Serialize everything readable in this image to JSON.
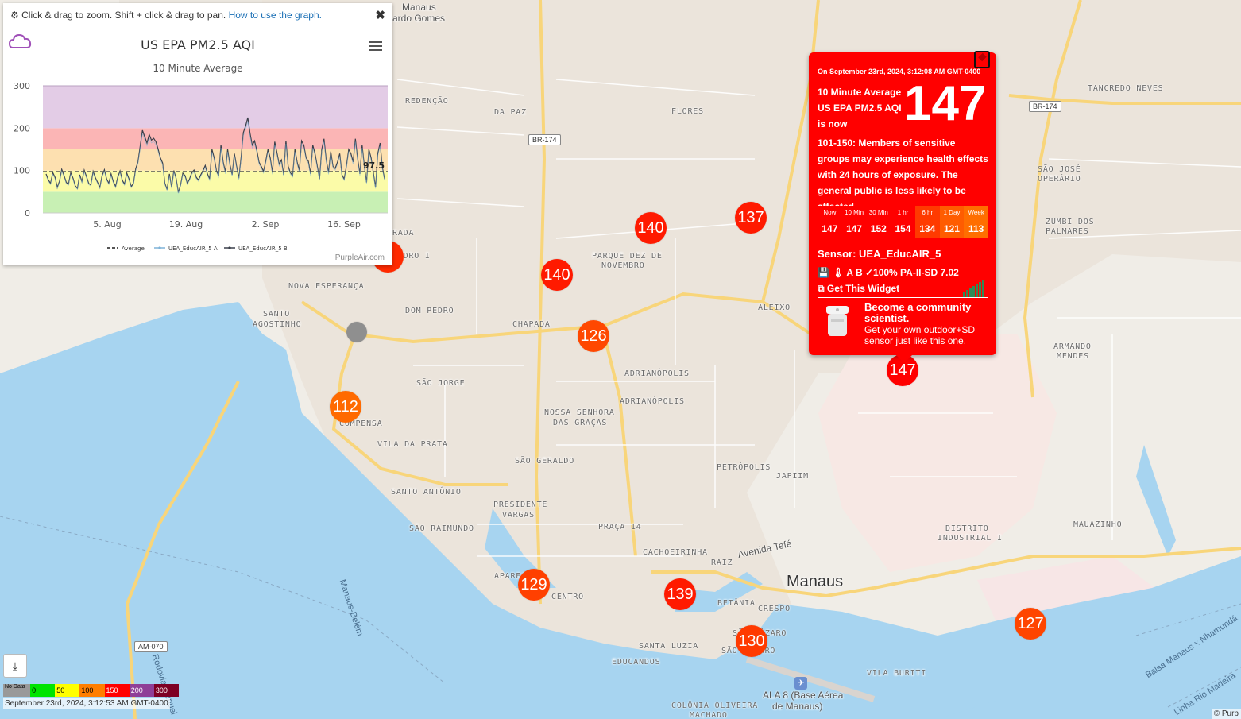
{
  "graph_panel": {
    "hint_text": "Click & drag to zoom. Shift + click & drag to pan.",
    "hint_link": "How to use the graph.",
    "close_icon": "close-icon",
    "credit": "PurpleAir.com",
    "chart_data": {
      "type": "line",
      "title": "US EPA PM2.5 AQI",
      "subtitle": "10 Minute Average",
      "x_tick_labels": [
        "5. Aug",
        "19. Aug",
        "2. Sep",
        "16. Sep"
      ],
      "y_tick_labels": [
        "300",
        "200",
        "100",
        "0"
      ],
      "ylim": [
        0,
        300
      ],
      "average_value": 97.5,
      "average_label": "97.5",
      "aqi_bands": [
        {
          "from": 0,
          "to": 50,
          "color": "#c8f0b4"
        },
        {
          "from": 50,
          "to": 100,
          "color": "#fbfba8"
        },
        {
          "from": 100,
          "to": 150,
          "color": "#fde0b0"
        },
        {
          "from": 150,
          "to": 200,
          "color": "#fbb5b5"
        },
        {
          "from": 200,
          "to": 300,
          "color": "#e3cce6"
        }
      ],
      "series": [
        {
          "name": "Average",
          "style": "dashed",
          "color": "#555555"
        },
        {
          "name": "UEA_EducAIR_5 A",
          "color": "#7fb3d8"
        },
        {
          "name": "UEA_EducAIR_5 B",
          "color": "#3a3f4a",
          "values": [
            92,
            78,
            70,
            95,
            84,
            60,
            75,
            103,
            88,
            72,
            68,
            95,
            82,
            64,
            58,
            90,
            74,
            101,
            86,
            70,
            66,
            98,
            83,
            72,
            60,
            88,
            102,
            80,
            70,
            92,
            74,
            62,
            85,
            99,
            77,
            68,
            94,
            80,
            62,
            70,
            104,
            121,
            158,
            195,
            180,
            165,
            185,
            172,
            176,
            168,
            150,
            130,
            118,
            70,
            55,
            92,
            60,
            100,
            82,
            48,
            66,
            94,
            88,
            70,
            80,
            95,
            101,
            84,
            78,
            90,
            100,
            112,
            92,
            80,
            150,
            130,
            100,
            88,
            160,
            120,
            96,
            150,
            115,
            90,
            140,
            110,
            82,
            130,
            190,
            205,
            225,
            188,
            160,
            170,
            148,
            120,
            110,
            98,
            122,
            150,
            130,
            95,
            168,
            142,
            115,
            125,
            90,
            170,
            110,
            95,
            88,
            150,
            120,
            100,
            170,
            160,
            130,
            122,
            92,
            160,
            140,
            110,
            80,
            150,
            175,
            125,
            95,
            145,
            110,
            105,
            120,
            140,
            90,
            80,
            110,
            150,
            140,
            120,
            175,
            128,
            92,
            160,
            110,
            72,
            150,
            130,
            95,
            60,
            140,
            165,
            108,
            80
          ]
        }
      ]
    }
  },
  "sensor_popup": {
    "date": "On September 23rd, 2024, 3:12:08 AM GMT-0400",
    "avg_line1": "10 Minute Average",
    "avg_line2": "US EPA PM2.5 AQI",
    "avg_line3": "is now",
    "big_value": "147",
    "description": "101-150: Members of sensitive groups may experience health effects with 24 hours of exposure. The general public is less likely to be affected.",
    "history": [
      {
        "label": "Now",
        "value": "147",
        "color": "#ff0000"
      },
      {
        "label": "10 Min",
        "value": "147",
        "color": "#ff0000"
      },
      {
        "label": "30 Min",
        "value": "152",
        "color": "#ff0000"
      },
      {
        "label": "1 hr",
        "value": "154",
        "color": "#ff0000"
      },
      {
        "label": "6 hr",
        "value": "134",
        "color": "#ff3a00"
      },
      {
        "label": "1 Day",
        "value": "121",
        "color": "#ff5c00"
      },
      {
        "label": "Week",
        "value": "113",
        "color": "#ff6e00"
      }
    ],
    "sensor_name": "Sensor: UEA_EducAIR_5",
    "sensor_info": "A B ✓100% PA-II-SD 7.02",
    "widget_link": "Get This Widget",
    "promo_title": "Become a community scientist.",
    "promo_text": "Get your own outdoor+SD sensor just like this one."
  },
  "markers": [
    {
      "value": "140",
      "color": "#ff1a00"
    },
    {
      "value": "137",
      "color": "#ff1a00"
    },
    {
      "value": "140",
      "color": "#ff1a00"
    },
    {
      "value": "126",
      "color": "#ff4800"
    },
    {
      "value": "112",
      "color": "#ff6a00"
    },
    {
      "value": "129",
      "color": "#ff4000"
    },
    {
      "value": "139",
      "color": "#ff1a00"
    },
    {
      "value": "130",
      "color": "#ff3a00"
    },
    {
      "value": "127",
      "color": "#ff4500"
    },
    {
      "value": "147",
      "color": "#ff0000"
    },
    {
      "value": "",
      "color": "#ff2a00"
    }
  ],
  "places": {
    "manaus_top": "Manaus",
    "eduardo": "ardo Gomes",
    "redencao": "REDENÇÃO",
    "da_paz": "DA PAZ",
    "flores": "FLORES",
    "tancredo": "TANCREDO NEVES",
    "sao_jose": "SÃO JOSÉ",
    "operario": "OPERÁRIO",
    "zumbi": "ZUMBI DOS",
    "palmares": "PALMARES",
    "parque1": "PARQUE DEZ DE",
    "parque2": "NOVEMBRO",
    "aleixo": "ALEIXO",
    "nova_esperanca": "NOVA ESPERANÇA",
    "santo_agostinho1": "SANTO",
    "santo_agostinho2": "AGOSTINHO",
    "dom_pedro": "DOM PEDRO",
    "chapada": "CHAPADA",
    "armando1": "ARMANDO",
    "armando2": "MENDES",
    "sao_jorge": "SÃO JORGE",
    "adrianopolis1": "ADRIANÓPOLIS",
    "adrianopolis2": "ADRIANÓPOLIS",
    "compensa": "COMPENSA",
    "vila_prata": "VILA DA PRATA",
    "nossa1": "NOSSA SENHORA",
    "nossa2": "DAS GRAÇAS",
    "sao_geraldo": "SÃO GERALDO",
    "petropolis": "PETRÓPOLIS",
    "japiim": "JAPIIM",
    "santo_antonio": "SANTO ANTÔNIO",
    "presidente1": "PRESIDENTE",
    "presidente2": "VARGAS",
    "sao_raimundo": "SÃO RAIMUNDO",
    "praca14": "PRAÇA 14",
    "distrito1": "DISTRITO",
    "distrito2": "INDUSTRIAL I",
    "mauazinho": "MAUAZINHO",
    "cachoeirinha": "CACHOEIRINHA",
    "raiz": "RAIZ",
    "aparecida": "APARECIDA",
    "centro": "CENTRO",
    "betania": "BETÂNIA",
    "crespo": "CRESPO",
    "manaus_city": "Manaus",
    "sao_lazaro1": "SÃO LÁZARO",
    "sao_lazaro2": "SÃO LÁZARO",
    "santa_luzia": "SANTA LUZIA",
    "educandos": "EDUCANDOS",
    "vila_buriti": "VILA BURITI",
    "colonia": "COLÔNIA OLIVEIRA",
    "machado": "MACHADO",
    "ala8_1": "ALA 8 (Base Aérea",
    "ala8_2": "de Manaus)",
    "avenida_tefe": "Avenida Tefé",
    "pedro_i": "PEDRO I",
    "rada": "RADA"
  },
  "roads": {
    "br174_a": "BR-174",
    "br174_b": "BR-174",
    "am070": "AM-070"
  },
  "water": {
    "manaus_belem": "Manaus-Belém",
    "rodovia": "Rodovia Manuel",
    "balsa": "Balsa Manaus x Nhamundá",
    "linha": "Linha Rio Madeira"
  },
  "legend": {
    "items": [
      {
        "label": "No Data",
        "color": "#999999"
      },
      {
        "label": "0",
        "color": "#00e400"
      },
      {
        "label": "50",
        "color": "#ffff00"
      },
      {
        "label": "100",
        "color": "#ff7e00"
      },
      {
        "label": "150",
        "color": "#ff0000"
      },
      {
        "label": "200",
        "color": "#8f3f97"
      },
      {
        "label": "300",
        "color": "#7e0023"
      }
    ],
    "timestamp": "September 23rd, 2024, 3:12:53 AM GMT-0400",
    "download_icon": "download-icon"
  },
  "attribution": "© Purp"
}
